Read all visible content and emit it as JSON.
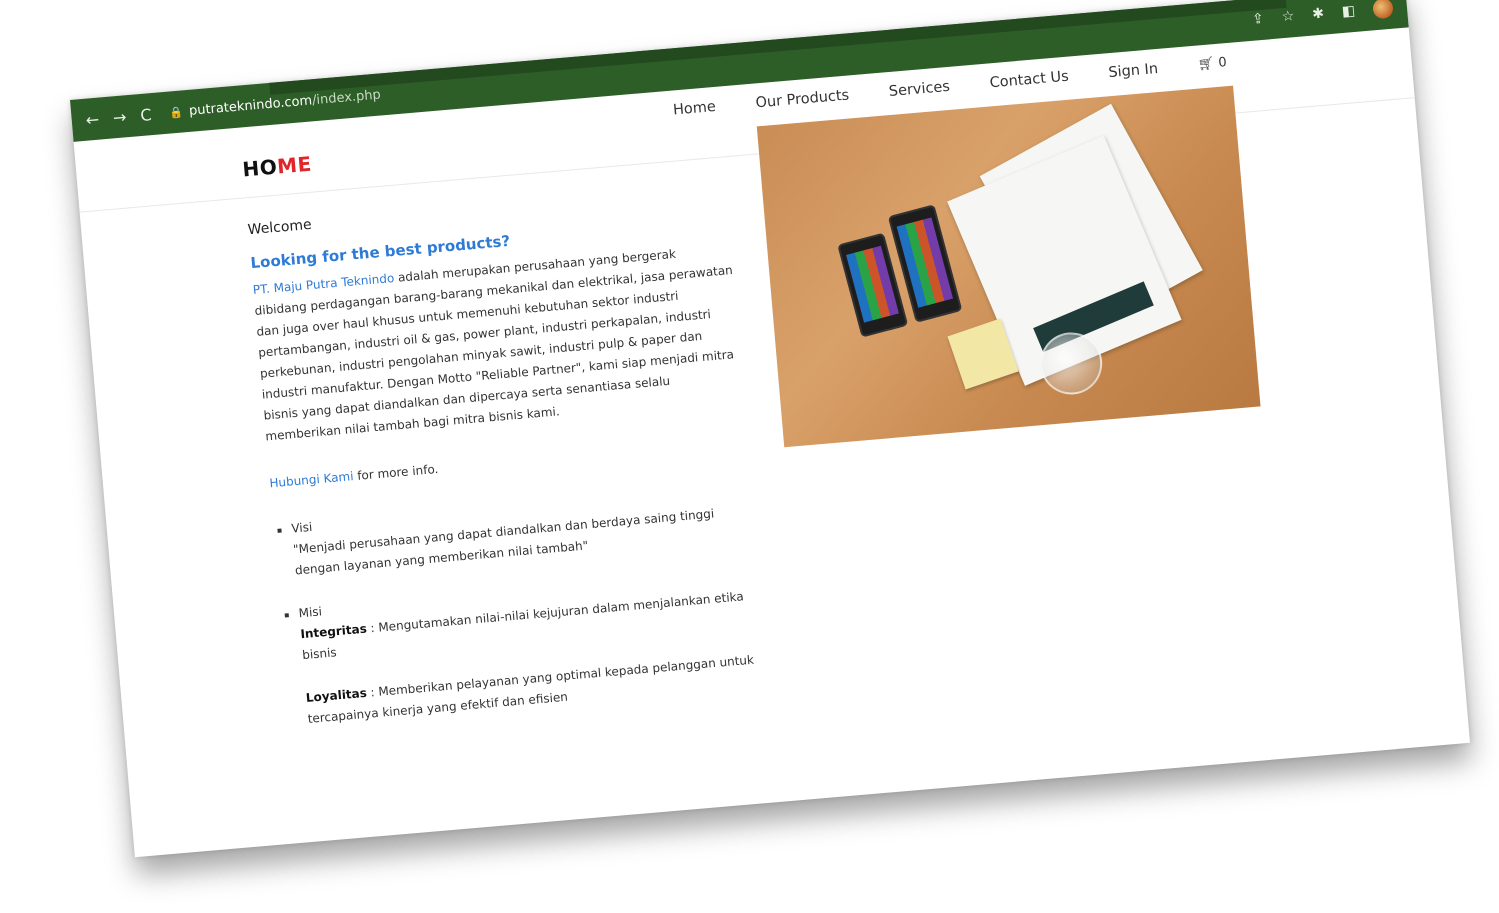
{
  "browser": {
    "url_host": "putrateknindo.com",
    "url_path": "/index.php",
    "nav_back": "←",
    "nav_forward": "→",
    "nav_reload": "C",
    "lock": "🔒",
    "actions": [
      "share-icon",
      "star-icon",
      "extensions-icon",
      "sidepanel-icon",
      "profile-avatar"
    ]
  },
  "nav": {
    "items": [
      "Home",
      "Our Products",
      "Services",
      "Contact Us",
      "Sign In"
    ],
    "cart_count": "0"
  },
  "logo": {
    "part1": "HO",
    "part2": "ME"
  },
  "content": {
    "welcome": "Welcome",
    "headline": "Looking for the best products?",
    "company_link": "PT. Maju Putra Teknindo",
    "intro_rest": " adalah merupakan perusahaan yang bergerak dibidang perdagangan barang-barang mekanikal dan elektrikal, jasa perawatan dan juga over haul khusus untuk memenuhi kebutuhan sektor industri pertambangan, industri oil & gas, power plant, industri perkapalan, industri perkebunan, industri pengolahan minyak sawit, industri pulp & paper dan industri manufaktur. Dengan Motto \"Reliable Partner\", kami siap menjadi mitra bisnis yang dapat diandalkan dan dipercaya serta senantiasa selalu memberikan nilai tambah bagi mitra bisnis kami.",
    "contact_link": "Hubungi Kami",
    "contact_rest": " for more info.",
    "visi_label": "Visi",
    "visi_text": "\"Menjadi perusahaan yang dapat diandalkan dan berdaya saing tinggi dengan layanan yang memberikan nilai tambah\"",
    "misi_label": "Misi",
    "integritas_label": "Integritas",
    "integritas_text": " : Mengutamakan nilai-nilai kejujuran dalam menjalankan etika bisnis",
    "loyalitas_label": "Loyalitas",
    "loyalitas_text": " : Memberikan pelayanan yang optimal kepada pelanggan untuk tercapainya kinerja yang efektif dan efisien"
  },
  "colors": {
    "chrome": "#2e5e28",
    "accent_link": "#2e7bd6",
    "logo_red": "#e0262a"
  }
}
